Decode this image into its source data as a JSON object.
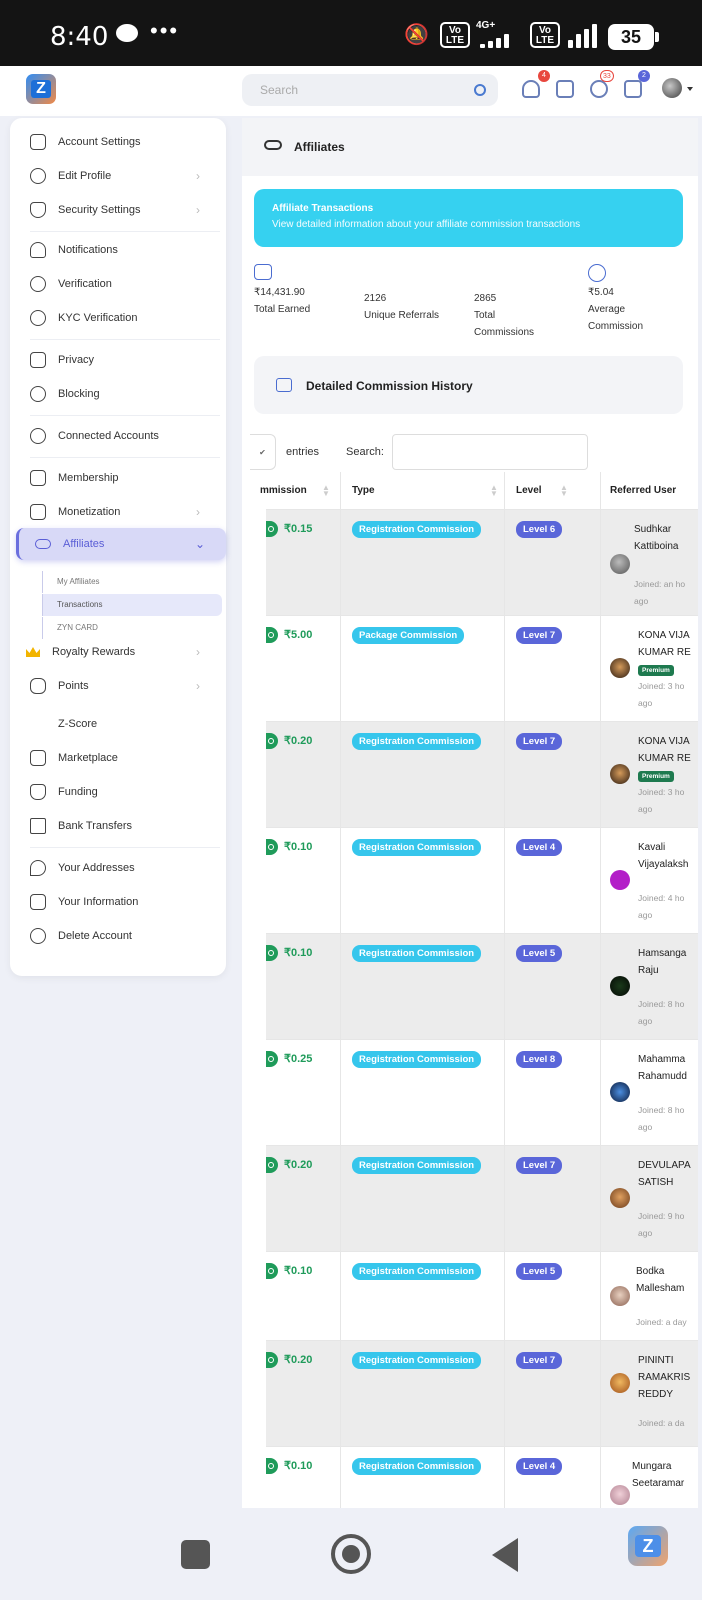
{
  "status_bar": {
    "time": "8:40",
    "battery": "35",
    "network": "4G+"
  },
  "header": {
    "logo_letter": "Z",
    "search_placeholder": "Search",
    "badges": {
      "friends": "4",
      "notifications": "33",
      "cart": "2"
    }
  },
  "sidebar": {
    "items": [
      {
        "label": "Account Settings",
        "icon": "sliders-icon"
      },
      {
        "label": "Edit Profile",
        "icon": "user-edit-icon",
        "chevron": "›"
      },
      {
        "label": "Security Settings",
        "icon": "shield-icon",
        "chevron": "›"
      },
      {
        "label": "Notifications",
        "icon": "bell-icon"
      },
      {
        "label": "Verification",
        "icon": "check-badge-icon"
      },
      {
        "label": "KYC Verification",
        "icon": "check-badge-icon"
      },
      {
        "label": "Privacy",
        "icon": "lock-icon"
      },
      {
        "label": "Blocking",
        "icon": "user-block-icon"
      },
      {
        "label": "Connected Accounts",
        "icon": "user-plus-icon"
      },
      {
        "label": "Membership",
        "icon": "crown-outline-icon"
      },
      {
        "label": "Monetization",
        "icon": "money-icon",
        "chevron": "›"
      },
      {
        "label": "Affiliates",
        "icon": "link-icon",
        "chevron": "⌄"
      },
      {
        "label": "Royalty Rewards",
        "icon": "crown-icon",
        "chevron": "›"
      },
      {
        "label": "Points",
        "icon": "piggy-bank-icon",
        "chevron": "›"
      },
      {
        "label": "Z-Score",
        "icon": ""
      },
      {
        "label": "Marketplace",
        "icon": "store-icon"
      },
      {
        "label": "Funding",
        "icon": "money-bag-icon"
      },
      {
        "label": "Bank Transfers",
        "icon": "bank-icon"
      },
      {
        "label": "Your Addresses",
        "icon": "location-icon"
      },
      {
        "label": "Your Information",
        "icon": "id-card-icon"
      },
      {
        "label": "Delete Account",
        "icon": "user-delete-icon"
      }
    ],
    "sub_items": [
      "My Affiliates",
      "Transactions",
      "ZYN CARD"
    ]
  },
  "main": {
    "breadcrumb": "Affiliates",
    "banner": {
      "title": "Affiliate Transactions",
      "subtitle": "View detailed information about your affiliate commission transactions"
    },
    "stats": {
      "total_earned": {
        "value": "₹14,431.90",
        "label": "Total Earned"
      },
      "unique_referrals": {
        "value": "2126",
        "label": "Unique Referrals"
      },
      "total_commissions": {
        "value": "2865",
        "label_line1": "Total",
        "label_line2": "Commissions"
      },
      "average_commission": {
        "value": "₹5.04",
        "label_line1": "Average",
        "label_line2": "Commission"
      }
    },
    "history_title": "Detailed Commission History",
    "entries_label": "entries",
    "search_label": "Search:",
    "columns": [
      "mmission",
      "Type",
      "Level",
      "Referred User"
    ],
    "rows": [
      {
        "amount": "₹0.15",
        "type": "Registration Commission",
        "level": "Level 6",
        "user": [
          "Sudhkar",
          "Kattiboina"
        ],
        "premium": "",
        "joined": [
          "Joined: an ho",
          "ago"
        ]
      },
      {
        "amount": "₹5.00",
        "type": "Package Commission",
        "level": "Level 7",
        "user": [
          "KONA VIJA",
          "KUMAR RE"
        ],
        "premium": "Premium",
        "joined": [
          "Joined: 3 ho",
          "ago"
        ]
      },
      {
        "amount": "₹0.20",
        "type": "Registration Commission",
        "level": "Level 7",
        "user": [
          "KONA VIJA",
          "KUMAR RE"
        ],
        "premium": "Premium",
        "joined": [
          "Joined: 3 ho",
          "ago"
        ]
      },
      {
        "amount": "₹0.10",
        "type": "Registration Commission",
        "level": "Level 4",
        "user": [
          "Kavali",
          "Vijayalaksh"
        ],
        "premium": "",
        "joined": [
          "Joined: 4 ho",
          "ago"
        ]
      },
      {
        "amount": "₹0.10",
        "type": "Registration Commission",
        "level": "Level 5",
        "user": [
          "Hamsanga",
          "Raju"
        ],
        "premium": "",
        "joined": [
          "Joined: 8 ho",
          "ago"
        ]
      },
      {
        "amount": "₹0.25",
        "type": "Registration Commission",
        "level": "Level 8",
        "user": [
          "Mahamma",
          "Rahamudd"
        ],
        "premium": "",
        "joined": [
          "Joined: 8 ho",
          "ago"
        ]
      },
      {
        "amount": "₹0.20",
        "type": "Registration Commission",
        "level": "Level 7",
        "user": [
          "DEVULAPA",
          "SATISH"
        ],
        "premium": "",
        "joined": [
          "Joined: 9 ho",
          "ago"
        ]
      },
      {
        "amount": "₹0.10",
        "type": "Registration Commission",
        "level": "Level 5",
        "user": [
          "Bodka",
          "Mallesham"
        ],
        "premium": "",
        "joined": [
          "Joined: a day"
        ]
      },
      {
        "amount": "₹0.20",
        "type": "Registration Commission",
        "level": "Level 7",
        "user": [
          "PININTI",
          "RAMAKRIS",
          "REDDY"
        ],
        "premium": "",
        "joined": [
          "Joined: a da"
        ]
      },
      {
        "amount": "₹0.10",
        "type": "Registration Commission",
        "level": "Level 4",
        "user": [
          "Mungara",
          "Seetaramar"
        ],
        "premium": "",
        "joined": []
      }
    ]
  },
  "colors": {
    "accent": "#5a5ed6",
    "banner": "#36d1f0",
    "type_badge": "#36c6ec",
    "level_badge": "#5a66d9",
    "amount": "#1f9b5a",
    "premium": "#1e7a4f"
  }
}
